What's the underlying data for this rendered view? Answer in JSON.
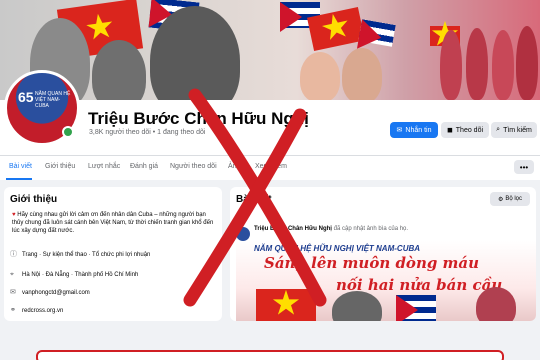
{
  "page": {
    "name": "Triệu Bước Chân Hữu Nghị",
    "stats": "3,8K người theo dõi • 1 đang theo dõi"
  },
  "avatar": {
    "number": "65",
    "caption": "NĂM QUAN HỆ VIỆT NAM-CUBA"
  },
  "actions": {
    "message": "Nhắn tin",
    "follow": "Theo dõi",
    "search": "Tìm kiếm"
  },
  "tabs": [
    "Bài viết",
    "Giới thiệu",
    "Lượt nhắc",
    "Đánh giá",
    "Người theo dõi",
    "Ảnh",
    "Xem thêm"
  ],
  "intro": {
    "title": "Giới thiệu",
    "description": "Hãy cùng nhau gửi lời cảm ơn đến nhân dân Cuba – những người bạn thủy chung đã luôn sát cánh bên Việt Nam, từ thời chiến tranh gian khổ đến lúc xây dựng đất nước.",
    "rows": [
      {
        "icon": "info-icon",
        "text": "Trang · Sự kiện thể thao · Tổ chức phi lợi nhuận"
      },
      {
        "icon": "location-icon",
        "text": "Hà Nội · Đà Nẵng · Thành phố Hồ Chí Minh"
      },
      {
        "icon": "email-icon",
        "text": "vanphongctd@gmail.com"
      },
      {
        "icon": "link-icon",
        "text": "redcross.org.vn"
      }
    ]
  },
  "posts": {
    "title": "Bài viết",
    "filter": "Bộ lọc",
    "author": "Triệu Bước Chân Hữu Nghị",
    "action": "đã cập nhật ảnh bìa của họ.",
    "image_line1": "NĂM QUAN HỆ HỮU NGHỊ VIỆT NAM-CUBA",
    "image_line2": "Sáng lên muôn dòng máu",
    "image_line3": "nối hai nửa bán cầu"
  },
  "colors": {
    "accent": "#1877f2",
    "cross": "#d01f24",
    "vn_red": "#da251d",
    "star_yellow": "#ffde00"
  }
}
